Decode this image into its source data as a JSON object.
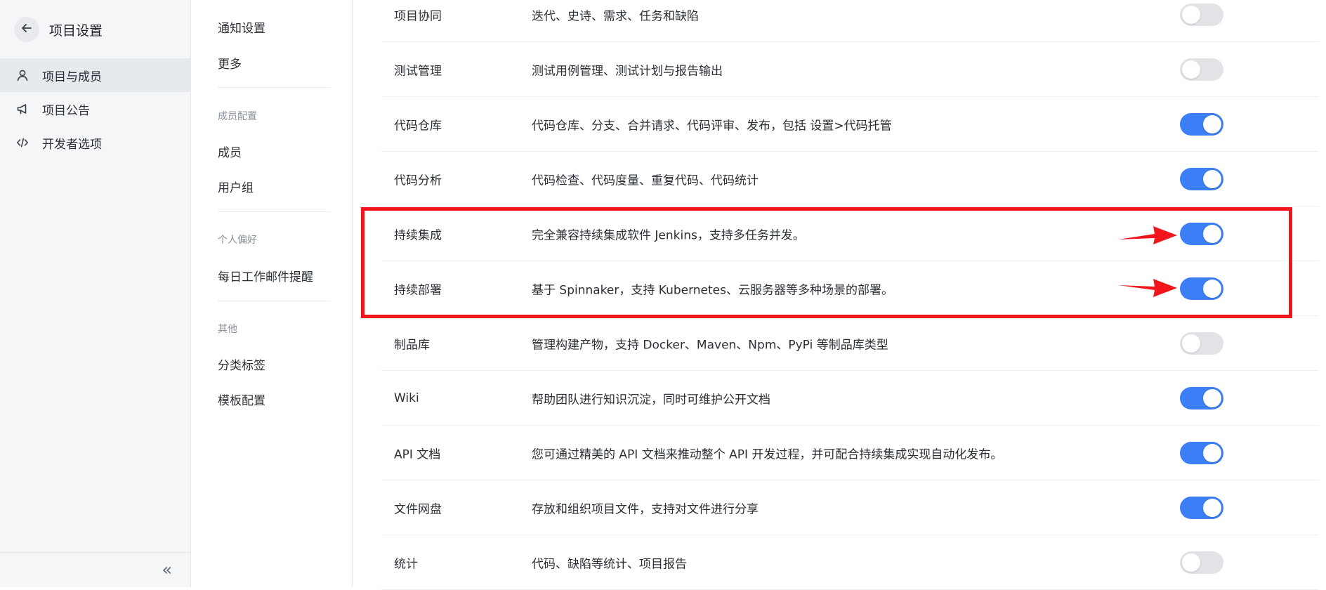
{
  "sidebar": {
    "title": "项目设置",
    "items": [
      {
        "label": "项目与成员",
        "icon": "user-icon",
        "active": true
      },
      {
        "label": "项目公告",
        "icon": "megaphone-icon",
        "active": false
      },
      {
        "label": "开发者选项",
        "icon": "code-icon",
        "active": false
      }
    ],
    "collapse_glyph": "«"
  },
  "midnav": {
    "items": [
      "通知设置",
      "更多"
    ],
    "group_members": "成员配置",
    "member_items": [
      "成员",
      "用户组"
    ],
    "group_prefs": "个人偏好",
    "pref_items": [
      "每日工作邮件提醒"
    ],
    "group_other": "其他",
    "other_items": [
      "分类标签",
      "模板配置"
    ]
  },
  "features": [
    {
      "name": "项目协同",
      "desc": "迭代、史诗、需求、任务和缺陷",
      "enabled": false
    },
    {
      "name": "测试管理",
      "desc": "测试用例管理、测试计划与报告输出",
      "enabled": false
    },
    {
      "name": "代码仓库",
      "desc": "代码仓库、分支、合并请求、代码评审、发布，包括 设置>代码托管",
      "enabled": true
    },
    {
      "name": "代码分析",
      "desc": "代码检查、代码度量、重复代码、代码统计",
      "enabled": true
    },
    {
      "name": "持续集成",
      "desc": "完全兼容持续集成软件 Jenkins，支持多任务并发。",
      "enabled": true
    },
    {
      "name": "持续部署",
      "desc": "基于 Spinnaker，支持 Kubernetes、云服务器等多种场景的部署。",
      "enabled": true
    },
    {
      "name": "制品库",
      "desc": "管理构建产物，支持 Docker、Maven、Npm、PyPi 等制品库类型",
      "enabled": false
    },
    {
      "name": "Wiki",
      "desc": "帮助团队进行知识沉淀，同时可维护公开文档",
      "enabled": true
    },
    {
      "name": "API 文档",
      "desc": "您可通过精美的 API 文档来推动整个 API 开发过程，并可配合持续集成实现自动化发布。",
      "enabled": true
    },
    {
      "name": "文件网盘",
      "desc": "存放和组织项目文件，支持对文件进行分享",
      "enabled": true
    },
    {
      "name": "统计",
      "desc": "代码、缺陷等统计、项目报告",
      "enabled": false
    }
  ],
  "colors": {
    "toggle_on": "#3c7ef5",
    "toggle_off": "#e1e3e7",
    "highlight": "#f0161c"
  }
}
